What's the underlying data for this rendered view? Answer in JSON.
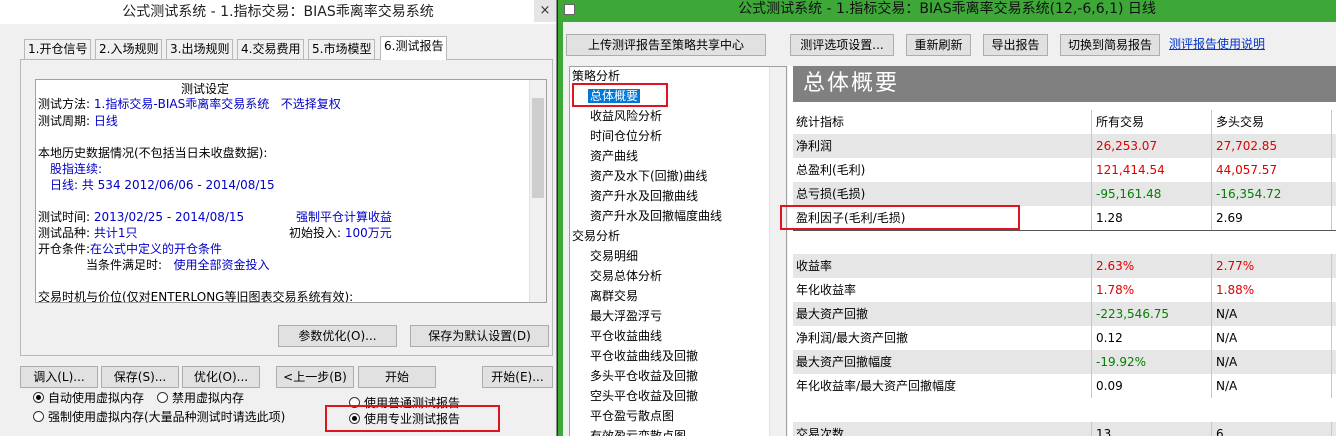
{
  "left": {
    "title": "公式测试系统 - 1.指标交易：BIAS乖离率交易系统",
    "close": "×",
    "tabs": [
      "1.开仓信号",
      "2.入场规则",
      "3.出场规则",
      "4.交易费用",
      "5.市场模型",
      "6.测试报告"
    ],
    "report": {
      "heading": "测试设定",
      "method_label": "测试方法:",
      "method_value": "1.指标交易-BIAS乖离率交易系统",
      "method_extra": "不选择复权",
      "period_label": "测试周期:",
      "period_value": "日线",
      "history_label": "本地历史数据情况(不包括当日未收盘数据):",
      "history_sub": "股指连续:",
      "history_detail": "日线: 共 534 2012/06/06 - 2014/08/15",
      "time_label": "测试时间:",
      "time_value": "2013/02/25 - 2014/08/15",
      "force_close": "强制平仓计算收益",
      "variety_label": "测试品种:",
      "variety_value": "共计1只",
      "invest_label": "初始投入:",
      "invest_value": "100万元",
      "open_label": "开仓条件:",
      "open_value": "在公式中定义的开仓条件",
      "condition_label": "当条件满足时:",
      "condition_value": "使用全部资金投入",
      "timing_label": "交易时机与价位(仅对ENTERLONG等旧图表交易系统有效):"
    },
    "buttons": {
      "param_opt": "参数优化(O)...",
      "save_default": "保存为默认设置(D)",
      "load": "调入(L)...",
      "save": "保存(S)...",
      "optimize": "优化(O)...",
      "prev": "<上一步(B)",
      "start": "开始",
      "start_e": "开始(E)..."
    },
    "radios": {
      "auto_mem": "自动使用虚拟内存",
      "disable_mem": "禁用虚拟内存",
      "force_mem": "强制使用虚拟内存(大量品种测试时请选此项)",
      "normal_report": "使用普通测试报告",
      "pro_report": "使用专业测试报告"
    }
  },
  "right": {
    "title": "公式测试系统 - 1.指标交易：BIAS乖离率交易系统(12,-6,6,1) 日线",
    "toolbar": {
      "upload": "上传测评报告至策略共享中心",
      "options": "测评选项设置...",
      "refresh": "重新刷新",
      "export": "导出报告",
      "simple": "切换到简易报告",
      "help": "测评报告使用说明"
    },
    "tree": {
      "strategy": "策略分析",
      "strategy_items": [
        "总体概要",
        "收益风险分析",
        "时间仓位分析",
        "资产曲线",
        "资产及水下(回撤)曲线",
        "资产升水及回撤曲线",
        "资产升水及回撤幅度曲线"
      ],
      "trade": "交易分析",
      "trade_items": [
        "交易明细",
        "交易总体分析",
        "离群交易",
        "最大浮盈浮亏",
        "平仓收益曲线",
        "平仓收益曲线及回撤",
        "多头平仓收益及回撤",
        "空头平仓收益及回撤",
        "平仓盈亏散点图",
        "有效盈亏变散点图"
      ]
    },
    "overview_title": "总体概要",
    "table": {
      "headers": [
        "统计指标",
        "所有交易",
        "多头交易"
      ],
      "rows": [
        [
          "净利润",
          "26,253.07",
          "27,702.85"
        ],
        [
          "总盈利(毛利)",
          "121,414.54",
          "44,057.57"
        ],
        [
          "总亏损(毛损)",
          "-95,161.48",
          "-16,354.72"
        ],
        [
          "盈利因子(毛利/毛损)",
          "1.28",
          "2.69"
        ],
        [
          "收益率",
          "2.63%",
          "2.77%"
        ],
        [
          "年化收益率",
          "1.78%",
          "1.88%"
        ],
        [
          "最大资产回撤",
          "-223,546.75",
          "N/A"
        ],
        [
          "净利润/最大资产回撤",
          "0.12",
          "N/A"
        ],
        [
          "最大资产回撤幅度",
          "-19.92%",
          "N/A"
        ],
        [
          "年化收益率/最大资产回撤幅度",
          "0.09",
          "N/A"
        ],
        [
          "交易次数",
          "13",
          "6"
        ]
      ]
    },
    "colors": {
      "title_bar": "#3da838",
      "positive": "#e00000",
      "negative": "#008000",
      "highlight": "#e0141e"
    }
  }
}
